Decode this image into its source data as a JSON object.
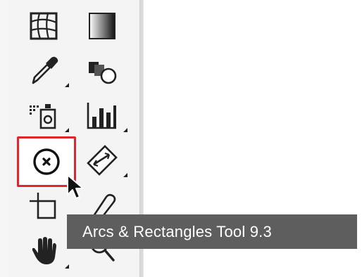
{
  "tooltip": {
    "text": "Arcs & Rectangles Tool 9.3"
  },
  "tools": [
    {
      "name": "mesh-tool",
      "icon": "mesh-grid-icon"
    },
    {
      "name": "gradient-tool",
      "icon": "gradient-icon"
    },
    {
      "name": "eyedropper-tool",
      "icon": "eyedropper-icon"
    },
    {
      "name": "blend-tool",
      "icon": "blend-shapes-icon"
    },
    {
      "name": "symbol-sprayer-tool",
      "icon": "symbol-sprayer-icon"
    },
    {
      "name": "column-graph-tool",
      "icon": "bar-chart-icon"
    },
    {
      "name": "arcs-rectangles-tool",
      "icon": "circle-x-icon",
      "selected": true
    },
    {
      "name": "slice-tool",
      "icon": "ruler-slice-icon"
    },
    {
      "name": "artboard-tool",
      "icon": "artboard-icon"
    },
    {
      "name": "eraser-tool",
      "icon": "eraser-icon"
    },
    {
      "name": "hand-tool",
      "icon": "hand-icon"
    },
    {
      "name": "zoom-tool",
      "icon": "magnifier-icon"
    }
  ],
  "colors": {
    "selection_border": "#e0262a",
    "tooltip_bg": "#5e5e5e",
    "tooltip_text": "#ffffff"
  }
}
